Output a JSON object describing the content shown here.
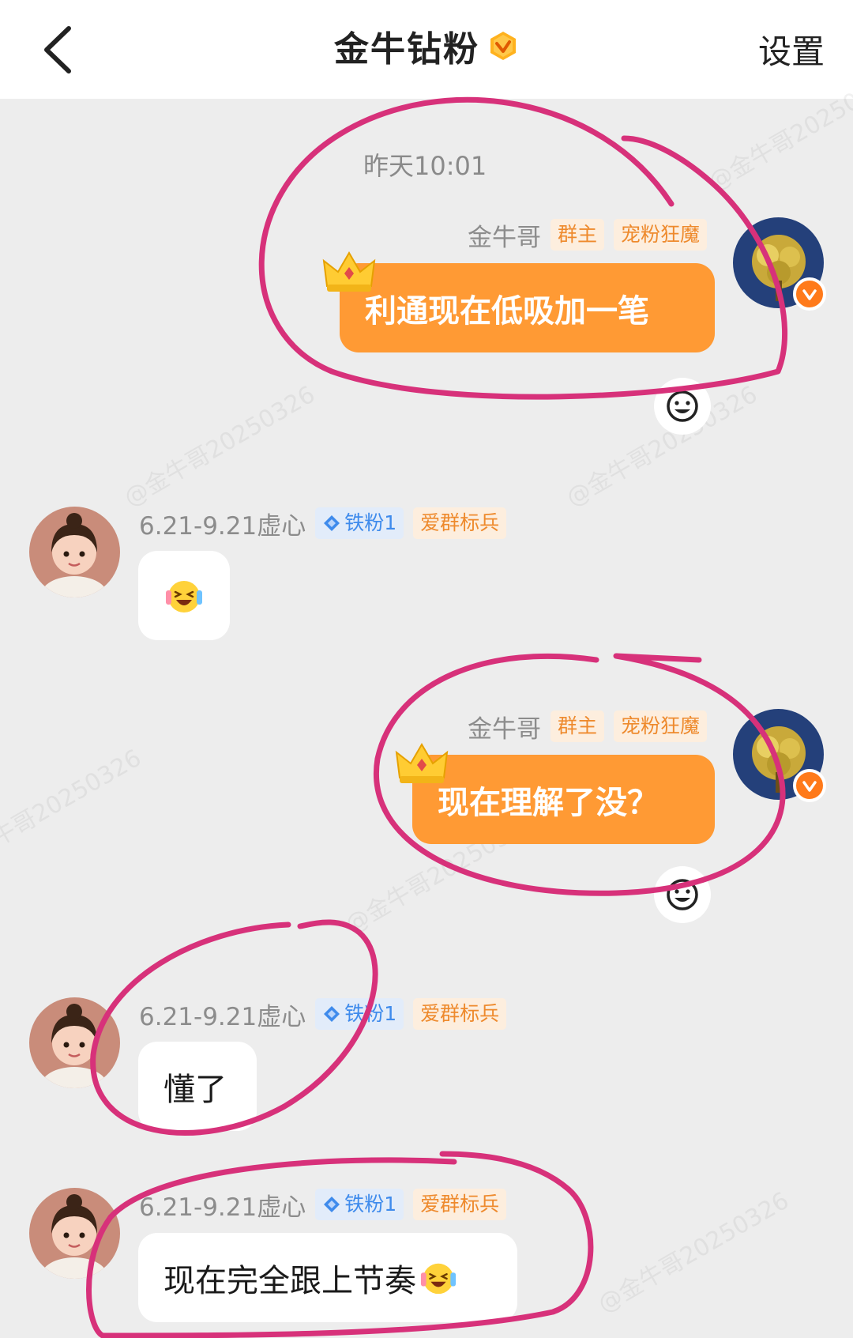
{
  "header": {
    "title": "金牛钻粉",
    "settings_label": "设置",
    "back_icon": "chevron-left-icon"
  },
  "watermark_text": "@金牛哥20250326",
  "chat": {
    "timestamp": "昨天10:01",
    "messages": [
      {
        "sender": "金牛哥",
        "tags": [
          "群主",
          "宠粉狂魔"
        ],
        "text": "利通现在低吸加一笔",
        "side": "right"
      },
      {
        "sender": "6.21-9.21虚心",
        "tags": [
          "铁粉1",
          "爱群标兵"
        ],
        "text": "",
        "emoji": "laughing-crying-emoji",
        "side": "left"
      },
      {
        "sender": "金牛哥",
        "tags": [
          "群主",
          "宠粉狂魔"
        ],
        "text": "现在理解了没？",
        "side": "right"
      },
      {
        "sender": "6.21-9.21虚心",
        "tags": [
          "铁粉1",
          "爱群标兵"
        ],
        "text": "懂了",
        "side": "left"
      },
      {
        "sender": "6.21-9.21虚心",
        "tags": [
          "铁粉1",
          "爱群标兵"
        ],
        "text": "现在完全跟上节奏",
        "emoji": "laughing-crying-emoji",
        "side": "left"
      }
    ]
  },
  "colors": {
    "accent_orange": "#ff9a34",
    "annotation_pink": "#d7317a",
    "background": "#ededed"
  }
}
